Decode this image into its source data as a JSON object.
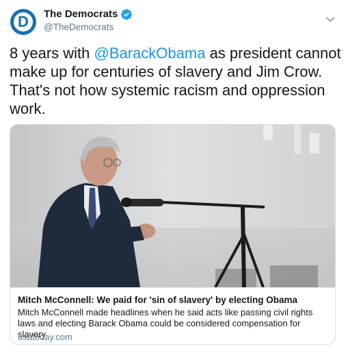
{
  "author": {
    "display_name": "The Democrats",
    "handle": "@TheDemocrats",
    "avatar_letter": "D",
    "avatar_color": "#1a6fb0",
    "verified": true,
    "verified_color": "#1da1f2"
  },
  "tweet": {
    "text_before": "8 years with ",
    "mention": "@BarackObama",
    "text_after": " as president cannot make up for centuries of slavery and Jim Crow. That's not how systemic racism and oppression work.",
    "mention_color": "#1b95e0"
  },
  "card": {
    "image_icon": "photo-of-speaker-at-microphone",
    "title": "Mitch McConnell: We paid for 'sin of slavery' by electing Obama",
    "description": "Mitch McConnell made headlines when he said acts like passing civil rights laws and electing Barack Obama could be considered compensation for slavery",
    "domain": "usatoday.com"
  },
  "menu_icon": "chevron-down-icon"
}
